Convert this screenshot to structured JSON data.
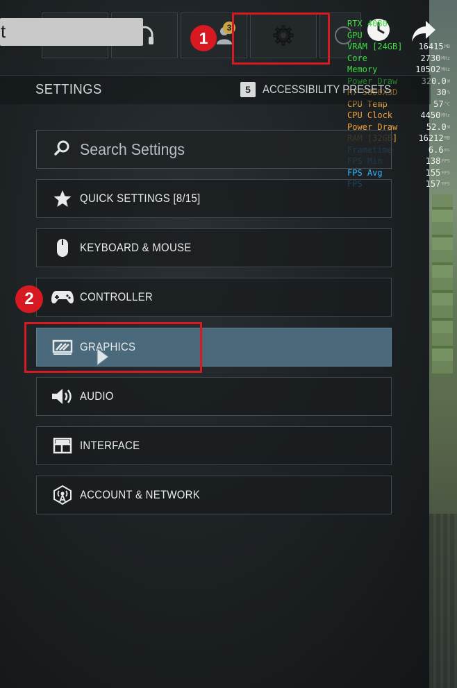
{
  "top_bar": {
    "title_fragment": "t",
    "notification_count": "3"
  },
  "overlay_icons": [
    "clock-icon",
    "share-arrow-icon"
  ],
  "perf_overlay": {
    "rows": [
      {
        "label": "RTX 4080",
        "value": "",
        "unit": "",
        "color": "#3ddc3d"
      },
      {
        "label": "GPU",
        "value": "",
        "unit": "",
        "color": "#3ddc3d"
      },
      {
        "label": "VRAM [24GB]",
        "value": "16415",
        "unit": "MB",
        "color": "#3ddc3d"
      },
      {
        "label": "Core",
        "value": "2730",
        "unit": "MHz",
        "color": "#3ddc3d"
      },
      {
        "label": "Memory",
        "value": "10502",
        "unit": "MHz",
        "color": "#3ddc3d"
      },
      {
        "label": "Power Draw",
        "value": "320.0",
        "unit": "W",
        "color": "#3ddc3d"
      },
      {
        "label": "R7 5800X3D",
        "value": "30",
        "unit": "%",
        "color": "#f0a23a"
      },
      {
        "label": "CPU Temp",
        "value": "57",
        "unit": "°C",
        "color": "#f0a23a"
      },
      {
        "label": "CPU Clock",
        "value": "4450",
        "unit": "MHz",
        "color": "#f0a23a"
      },
      {
        "label": "Power Draw",
        "value": "52.0",
        "unit": "W",
        "color": "#f0a23a"
      },
      {
        "label": "RAM [32GB]",
        "value": "16212",
        "unit": "MB",
        "color": "#f0a23a"
      },
      {
        "label": "Frametime",
        "value": "6.6",
        "unit": "ms",
        "color": "#33b6ff"
      },
      {
        "label": "FPS Min",
        "value": "138",
        "unit": "FPS",
        "color": "#33b6ff"
      },
      {
        "label": "FPS Avg",
        "value": "155",
        "unit": "FPS",
        "color": "#33b6ff"
      },
      {
        "label": "FPS",
        "value": "157",
        "unit": "FPS",
        "color": "#33b6ff"
      }
    ]
  },
  "header": {
    "title": "SETTINGS",
    "key_hint": "5",
    "key_hint_label": "ACCESSIBILITY PRESETS"
  },
  "search": {
    "placeholder": "Search Settings"
  },
  "menu": {
    "items": [
      {
        "label": "QUICK SETTINGS [8/15]",
        "icon": "star-icon"
      },
      {
        "label": "KEYBOARD & MOUSE",
        "icon": "mouse-icon"
      },
      {
        "label": "CONTROLLER",
        "icon": "gamepad-icon"
      },
      {
        "label": "GRAPHICS",
        "icon": "graphics-display-icon",
        "active": true
      },
      {
        "label": "AUDIO",
        "icon": "speaker-icon"
      },
      {
        "label": "INTERFACE",
        "icon": "interface-layout-icon"
      },
      {
        "label": "ACCOUNT & NETWORK",
        "icon": "network-tower-icon"
      }
    ]
  },
  "annotations": {
    "step1": "1",
    "step2": "2",
    "color": "#d71921"
  }
}
